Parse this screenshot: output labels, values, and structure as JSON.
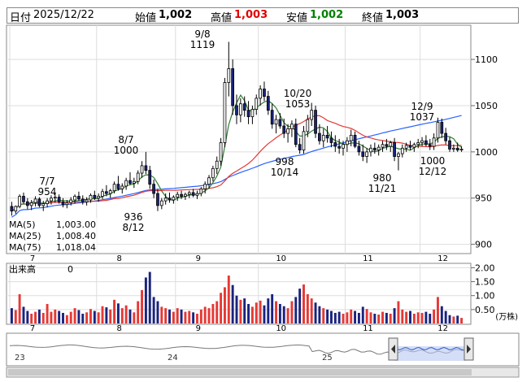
{
  "header": {
    "date_label": "日付",
    "date_value": "2025/12/22",
    "open_label": "始値",
    "open_value": "1,002",
    "high_label": "高値",
    "high_value": "1,003",
    "low_label": "安値",
    "low_value": "1,002",
    "close_label": "終値",
    "close_value": "1,003"
  },
  "chart_data": {
    "type": "candlestick",
    "price_axis": {
      "ticks": [
        "900",
        "950",
        "1000",
        "1050",
        "1100"
      ],
      "range": [
        890,
        1137
      ]
    },
    "volume_axis": {
      "ticks": [
        "0.50",
        "1.00",
        "1.50",
        "2.00"
      ],
      "unit": "(万株)",
      "range": [
        0,
        2.1
      ]
    },
    "month_labels": [
      "7",
      "8",
      "9",
      "10",
      "11",
      "12"
    ],
    "navigator_labels": [
      "23",
      "24",
      "25"
    ],
    "legend": [
      {
        "label": "MA(5)",
        "value": "1,003.00",
        "color": "#2e7d32"
      },
      {
        "label": "MA(25)",
        "value": "1,008.40",
        "color": "#e53935"
      },
      {
        "label": "MA(75)",
        "value": "1,018.04",
        "color": "#2962ff"
      }
    ],
    "volume_label": "出来高",
    "volume_value": "0",
    "annotations": [
      {
        "date": "7/7",
        "value": "954"
      },
      {
        "date": "8/7",
        "value": "1000"
      },
      {
        "date": "8/12",
        "value": "936"
      },
      {
        "date": "9/8",
        "value": "1119"
      },
      {
        "date": "10/20",
        "value": "1053"
      },
      {
        "date": "10/14",
        "value": "998"
      },
      {
        "date": "11/21",
        "value": "980"
      },
      {
        "date": "12/9",
        "value": "1037"
      },
      {
        "date": "12/12",
        "value": "1000"
      }
    ],
    "ohlc": [
      [
        941,
        946,
        931,
        936
      ],
      [
        936,
        942,
        933,
        941
      ],
      [
        941,
        954,
        939,
        952
      ],
      [
        952,
        956,
        944,
        946
      ],
      [
        946,
        950,
        938,
        942
      ],
      [
        942,
        948,
        937,
        945
      ],
      [
        945,
        952,
        941,
        949
      ],
      [
        949,
        951,
        940,
        942
      ],
      [
        942,
        947,
        936,
        944
      ],
      [
        944,
        950,
        940,
        947
      ],
      [
        947,
        953,
        943,
        950
      ],
      [
        950,
        955,
        945,
        951
      ],
      [
        951,
        954,
        944,
        946
      ],
      [
        946,
        950,
        940,
        943
      ],
      [
        943,
        948,
        939,
        945
      ],
      [
        945,
        951,
        942,
        948
      ],
      [
        948,
        954,
        944,
        952
      ],
      [
        952,
        957,
        947,
        949
      ],
      [
        949,
        953,
        943,
        946
      ],
      [
        946,
        951,
        942,
        948
      ],
      [
        948,
        955,
        945,
        953
      ],
      [
        953,
        958,
        948,
        950
      ],
      [
        950,
        955,
        946,
        952
      ],
      [
        952,
        960,
        949,
        957
      ],
      [
        957,
        964,
        952,
        955
      ],
      [
        955,
        960,
        950,
        958
      ],
      [
        958,
        968,
        955,
        965
      ],
      [
        965,
        974,
        958,
        960
      ],
      [
        960,
        966,
        955,
        963
      ],
      [
        963,
        972,
        959,
        969
      ],
      [
        969,
        978,
        964,
        966
      ],
      [
        966,
        972,
        961,
        968
      ],
      [
        968,
        980,
        965,
        977
      ],
      [
        977,
        990,
        972,
        985
      ],
      [
        985,
        1000,
        976,
        980
      ],
      [
        980,
        985,
        960,
        965
      ],
      [
        965,
        970,
        950,
        955
      ],
      [
        955,
        960,
        936,
        942
      ],
      [
        942,
        950,
        938,
        947
      ],
      [
        947,
        955,
        943,
        950
      ],
      [
        950,
        956,
        945,
        948
      ],
      [
        948,
        953,
        944,
        951
      ],
      [
        951,
        957,
        947,
        954
      ],
      [
        954,
        958,
        949,
        952
      ],
      [
        952,
        956,
        948,
        954
      ],
      [
        954,
        958,
        950,
        956
      ],
      [
        956,
        960,
        951,
        953
      ],
      [
        953,
        958,
        949,
        955
      ],
      [
        955,
        962,
        952,
        960
      ],
      [
        960,
        968,
        955,
        965
      ],
      [
        965,
        975,
        960,
        972
      ],
      [
        972,
        985,
        968,
        982
      ],
      [
        982,
        995,
        976,
        990
      ],
      [
        990,
        1015,
        985,
        1010
      ],
      [
        1010,
        1080,
        1005,
        1075
      ],
      [
        1075,
        1119,
        1060,
        1090
      ],
      [
        1090,
        1100,
        1040,
        1050
      ],
      [
        1050,
        1062,
        1030,
        1040
      ],
      [
        1040,
        1058,
        1032,
        1052
      ],
      [
        1052,
        1060,
        1038,
        1045
      ],
      [
        1045,
        1055,
        1030,
        1038
      ],
      [
        1038,
        1050,
        1030,
        1046
      ],
      [
        1046,
        1062,
        1040,
        1058
      ],
      [
        1058,
        1072,
        1050,
        1068
      ],
      [
        1068,
        1076,
        1055,
        1060
      ],
      [
        1060,
        1066,
        1040,
        1045
      ],
      [
        1045,
        1052,
        1025,
        1030
      ],
      [
        1030,
        1040,
        1020,
        1035
      ],
      [
        1035,
        1042,
        1025,
        1028
      ],
      [
        1028,
        1036,
        1015,
        1020
      ],
      [
        1020,
        1030,
        1010,
        1025
      ],
      [
        1025,
        1034,
        1016,
        1030
      ],
      [
        1030,
        1036,
        1005,
        1008
      ],
      [
        1008,
        1015,
        998,
        1002
      ],
      [
        1002,
        1028,
        998,
        1022
      ],
      [
        1022,
        1040,
        1016,
        1035
      ],
      [
        1035,
        1053,
        1028,
        1045
      ],
      [
        1045,
        1050,
        1015,
        1020
      ],
      [
        1020,
        1030,
        1008,
        1012
      ],
      [
        1012,
        1025,
        1005,
        1018
      ],
      [
        1018,
        1028,
        1010,
        1015
      ],
      [
        1015,
        1022,
        1005,
        1010
      ],
      [
        1010,
        1018,
        1000,
        1006
      ],
      [
        1006,
        1014,
        998,
        1004
      ],
      [
        1004,
        1012,
        996,
        1008
      ],
      [
        1008,
        1016,
        1000,
        1012
      ],
      [
        1012,
        1024,
        1006,
        1018
      ],
      [
        1018,
        1022,
        1004,
        1006
      ],
      [
        1006,
        1012,
        996,
        1000
      ],
      [
        1000,
        1008,
        990,
        995
      ],
      [
        995,
        1004,
        988,
        1000
      ],
      [
        1000,
        1008,
        995,
        1004
      ],
      [
        1004,
        1010,
        998,
        1002
      ],
      [
        1002,
        1008,
        996,
        1005
      ],
      [
        1005,
        1012,
        1000,
        1008
      ],
      [
        1008,
        1014,
        1002,
        1006
      ],
      [
        1006,
        1012,
        1000,
        1010
      ],
      [
        1010,
        1015,
        990,
        995
      ],
      [
        995,
        1000,
        980,
        998
      ],
      [
        998,
        1008,
        994,
        1004
      ],
      [
        1004,
        1010,
        1000,
        1007
      ],
      [
        1007,
        1012,
        1002,
        1005
      ],
      [
        1005,
        1010,
        1000,
        1008
      ],
      [
        1008,
        1014,
        1004,
        1010
      ],
      [
        1010,
        1016,
        1006,
        1012
      ],
      [
        1012,
        1018,
        1006,
        1008
      ],
      [
        1008,
        1014,
        1002,
        1006
      ],
      [
        1006,
        1020,
        1002,
        1015
      ],
      [
        1015,
        1037,
        1010,
        1032
      ],
      [
        1032,
        1036,
        1015,
        1020
      ],
      [
        1020,
        1026,
        1008,
        1012
      ],
      [
        1012,
        1016,
        1000,
        1003
      ],
      [
        1003,
        1008,
        1000,
        1004
      ],
      [
        1004,
        1010,
        1000,
        1002
      ],
      [
        1002,
        1006,
        1000,
        1003
      ]
    ],
    "volume": [
      0.55,
      0.48,
      1.05,
      0.6,
      0.45,
      0.35,
      0.42,
      0.5,
      0.38,
      0.7,
      0.42,
      0.5,
      0.45,
      0.38,
      0.3,
      0.42,
      0.55,
      0.48,
      0.35,
      0.4,
      0.52,
      0.45,
      0.4,
      0.62,
      0.58,
      0.5,
      0.85,
      0.72,
      0.55,
      0.65,
      0.5,
      0.4,
      0.8,
      1.2,
      1.65,
      1.85,
      0.95,
      0.8,
      0.6,
      0.55,
      0.5,
      0.42,
      0.55,
      0.5,
      0.42,
      0.45,
      0.4,
      0.35,
      0.5,
      0.6,
      0.55,
      0.7,
      0.8,
      1.1,
      1.3,
      1.72,
      1.38,
      1.0,
      0.85,
      0.9,
      0.7,
      0.6,
      0.75,
      0.82,
      0.65,
      0.9,
      1.05,
      0.8,
      0.7,
      0.62,
      0.55,
      0.8,
      0.95,
      1.25,
      1.4,
      1.05,
      0.9,
      0.75,
      0.62,
      0.55,
      0.5,
      0.45,
      0.38,
      0.42,
      0.35,
      0.4,
      0.5,
      0.45,
      0.38,
      0.6,
      0.52,
      0.4,
      0.35,
      0.32,
      0.42,
      0.38,
      0.35,
      0.55,
      0.8,
      0.5,
      0.42,
      0.45,
      0.35,
      0.4,
      0.38,
      0.42,
      0.35,
      0.5,
      0.95,
      0.62,
      0.45,
      0.3,
      0.25,
      0.28,
      0.2
    ]
  }
}
